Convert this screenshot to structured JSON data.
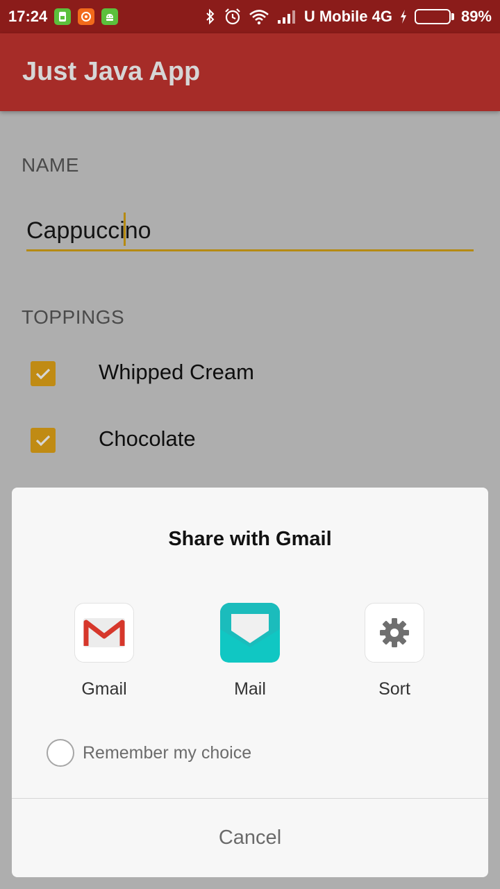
{
  "status_bar": {
    "time": "17:24",
    "carrier": "U Mobile 4G",
    "battery_percent": "89%",
    "battery_level": 0.89,
    "app_icons": [
      "sim-icon",
      "mi-icon",
      "android-icon"
    ],
    "system_icons": [
      "bluetooth-icon",
      "alarm-icon",
      "wifi-icon",
      "signal-icon",
      "charging-icon",
      "battery-icon"
    ],
    "colors": {
      "background": "#8b1c1a",
      "battery_fill": "#56d318"
    }
  },
  "app_bar": {
    "title": "Just Java App",
    "color": "#a62c28"
  },
  "form": {
    "name_label": "NAME",
    "name_value": "Cappuccino",
    "toppings_label": "TOPPINGS",
    "toppings": [
      {
        "label": "Whipped Cream",
        "checked": true
      },
      {
        "label": "Chocolate",
        "checked": true
      }
    ],
    "accent_color": "#c08b14"
  },
  "share_dialog": {
    "title": "Share with Gmail",
    "apps": [
      {
        "label": "Gmail",
        "icon": "gmail-icon"
      },
      {
        "label": "Mail",
        "icon": "mail-icon"
      },
      {
        "label": "Sort",
        "icon": "gear-icon"
      }
    ],
    "remember_label": "Remember my choice",
    "remember_checked": false,
    "cancel_label": "Cancel"
  }
}
